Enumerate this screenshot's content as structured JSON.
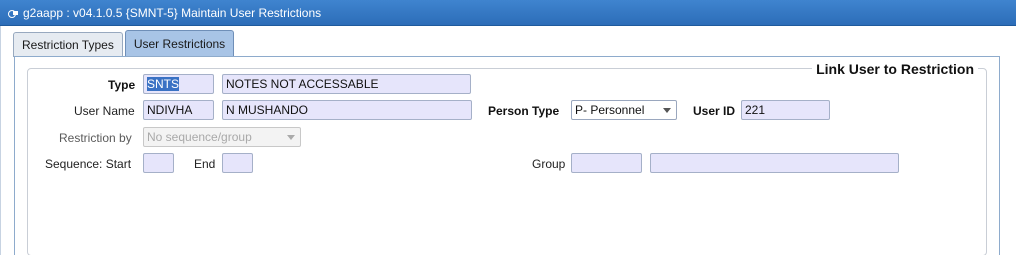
{
  "window": {
    "title": "g2aapp : v04.1.0.5  {SMNT-5} Maintain User Restrictions"
  },
  "tabs": [
    {
      "label": "Restriction Types"
    },
    {
      "label": "User Restrictions"
    }
  ],
  "form": {
    "legend": "Link User to Restriction",
    "type": {
      "label": "Type",
      "code": "SNTS",
      "description": "NOTES NOT ACCESSABLE"
    },
    "user_name": {
      "label": "User Name",
      "code": "NDIVHA",
      "description": "N MUSHANDO"
    },
    "person_type": {
      "label": "Person Type",
      "value": "P- Personnel"
    },
    "user_id": {
      "label": "User ID",
      "value": "221"
    },
    "restriction_by": {
      "label": "Restriction by",
      "value": "No sequence/group"
    },
    "sequence_start": {
      "label": "Sequence: Start",
      "value": ""
    },
    "sequence_end": {
      "label": "End",
      "value": ""
    },
    "group": {
      "label": "Group",
      "code": "",
      "description": ""
    }
  },
  "colors": {
    "titlebar": "#3074c0",
    "input_bg": "#e6e5fb",
    "active_tab": "#a8c4e6"
  },
  "icons": {
    "app": "app-gear-icon",
    "dropdown": "chevron-down-icon"
  }
}
